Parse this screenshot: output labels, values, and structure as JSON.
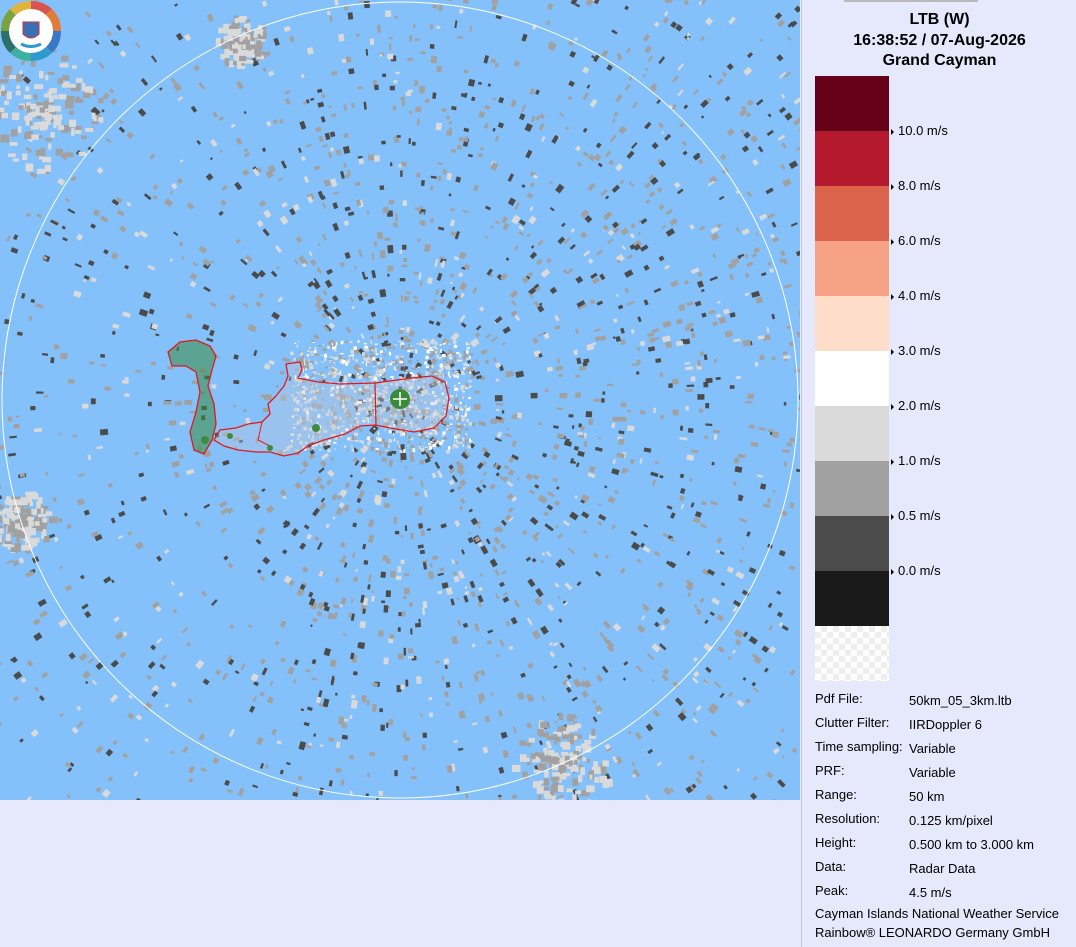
{
  "header": {
    "station": "LTB (W)",
    "datetime": "16:38:52 / 07-Aug-2026",
    "location": "Grand Cayman"
  },
  "legend": {
    "swatches": [
      {
        "color": "#650019"
      },
      {
        "color": "#b4192d"
      },
      {
        "color": "#db634c"
      },
      {
        "color": "#f6a285"
      },
      {
        "color": "#ffddcb"
      },
      {
        "color": "#ffffff"
      },
      {
        "color": "#dadada"
      },
      {
        "color": "#a1a1a1"
      },
      {
        "color": "#4b4b4b"
      },
      {
        "color": "#1a1a1a"
      }
    ],
    "nodata_swatch": "checkerboard",
    "ticks": [
      "10.0 m/s",
      "8.0 m/s",
      "6.0 m/s",
      "4.0 m/s",
      "3.0 m/s",
      "2.0 m/s",
      "1.0 m/s",
      "0.5 m/s",
      "0.0 m/s"
    ]
  },
  "info": [
    {
      "label": "Pdf File:",
      "value": "50km_05_3km.ltb"
    },
    {
      "label": "Clutter Filter:",
      "value": "IIRDoppler 6"
    },
    {
      "label": "Time sampling:",
      "value": "Variable"
    },
    {
      "label": "PRF:",
      "value": "Variable"
    },
    {
      "label": "Range:",
      "value": "50 km"
    },
    {
      "label": "Resolution:",
      "value": "0.125 km/pixel"
    },
    {
      "label": "Height:",
      "value": "0.500 km to 3.000 km"
    },
    {
      "label": "Data:",
      "value": "Radar Data"
    },
    {
      "label": "Peak:",
      "value": "4.5 m/s"
    }
  ],
  "footer": {
    "line1": "Cayman Islands National Weather Service",
    "line2": "Rainbow® LEONARDO Germany GmbH"
  },
  "map": {
    "background": "#84c1fb",
    "range_ring_color": "#ffffff",
    "coastline_color": "#e01a1a",
    "land_color": "#3e8a3e",
    "radar_site_icon": "crosshair-circle-icon",
    "logo_icon": "weather-service-logo-icon"
  }
}
